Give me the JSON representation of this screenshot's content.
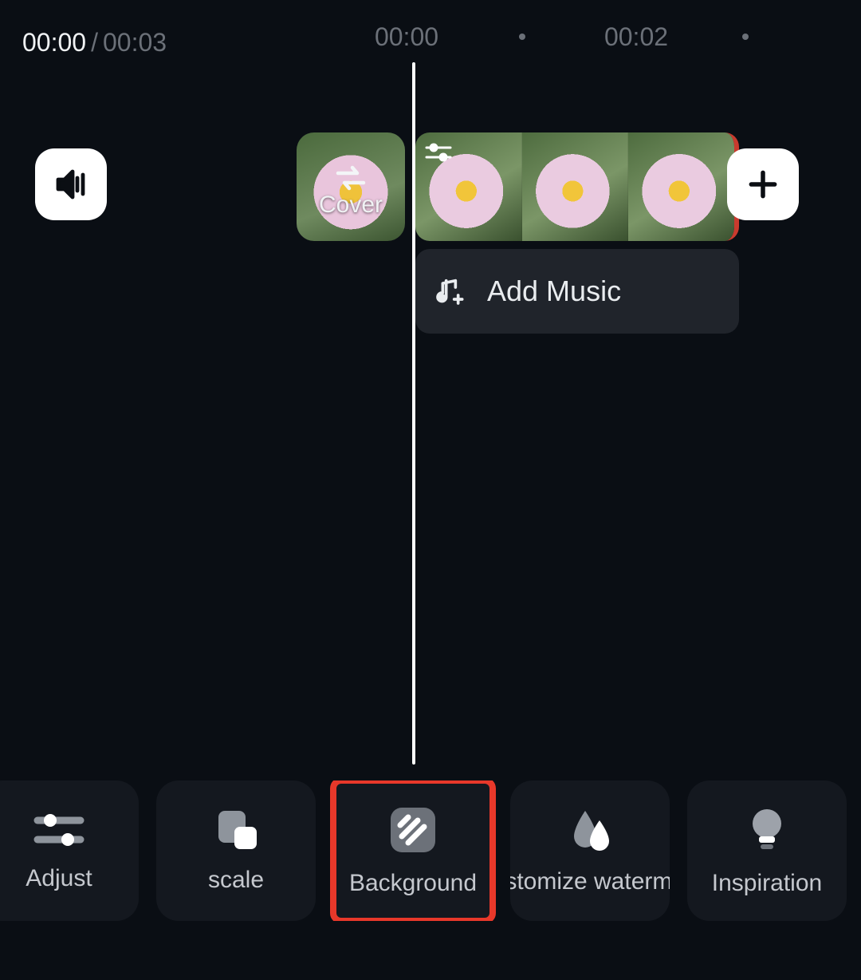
{
  "time": {
    "current": "00:00",
    "separator": "/",
    "total": "00:03"
  },
  "timeline_ticks": {
    "tick0": "00:00",
    "tick2": "00:02"
  },
  "cover": {
    "label": "Cover"
  },
  "music_bar": {
    "label": "Add Music"
  },
  "toolbar": {
    "adjust": "Adjust",
    "scale": "scale",
    "background": "Background",
    "watermark": "Customize watermark",
    "inspiration": "Inspiration"
  },
  "icons": {
    "volume": "volume-icon",
    "swap": "swap-icon",
    "sliders_small": "sliders-icon",
    "plus": "plus-icon",
    "music_add": "music-add-icon",
    "adjust": "sliders-icon",
    "scale": "scale-icon",
    "background": "pattern-icon",
    "watermark": "water-drop-icon",
    "inspiration": "lightbulb-icon"
  }
}
